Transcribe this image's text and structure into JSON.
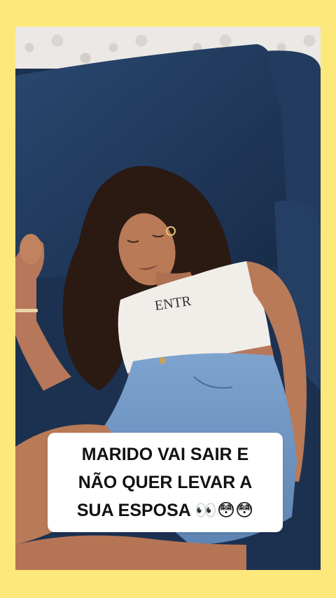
{
  "caption": {
    "text": "MARIDO VAI SAIR E\nNÃO QUER LEVAR A\nSUA ESPOSA 👀😳😳"
  },
  "shirt": {
    "print": "ENTR"
  },
  "colors": {
    "background_frame": "#fde97b",
    "sofa": "#1f3556",
    "sofa_highlight": "#2b4870",
    "shirt": "#f1eeea",
    "denim": "#6f96c4",
    "skin": "#b97a57",
    "hair": "#2a1a12"
  }
}
